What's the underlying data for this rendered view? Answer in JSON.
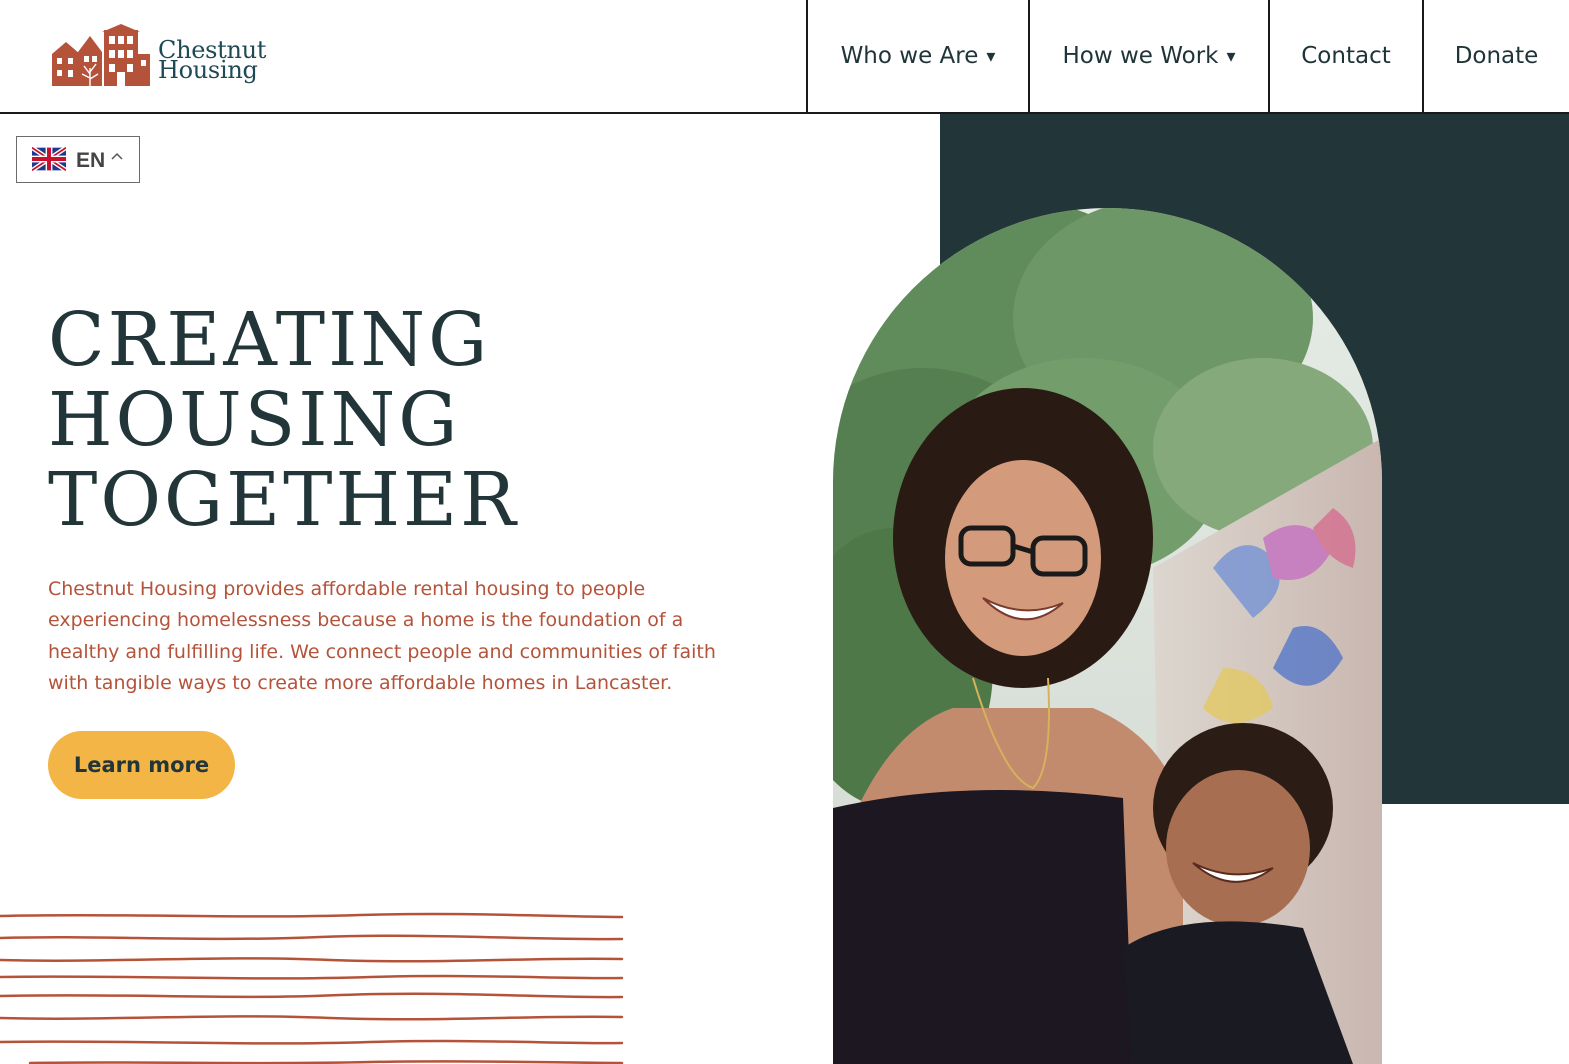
{
  "header": {
    "logo": {
      "line1": "Chestnut",
      "line2": "Housing"
    },
    "nav": [
      {
        "label": "Who we Are",
        "caret": "▾"
      },
      {
        "label": "How we Work",
        "caret": "▾"
      },
      {
        "label": "Contact"
      },
      {
        "label": "Donate"
      }
    ]
  },
  "language": {
    "code": "EN"
  },
  "hero": {
    "headline": [
      "CREATING",
      "HOUSING",
      "TOGETHER"
    ],
    "description": "Chestnut Housing provides affordable rental housing to people experiencing homelessness because a home is the foundation of a healthy and fulfilling life. We connect people and communities of faith with tangible ways to create more affordable homes in Lancaster.",
    "cta_label": "Learn more"
  },
  "colors": {
    "dark_teal": "#223539",
    "brick": "#b5533a",
    "button_gold": "#f3b546",
    "logo_teal": "#1f4a55"
  },
  "icons": [
    "chestnut-housing-logo-icon",
    "uk-flag-icon",
    "chevron-up-icon",
    "dropdown-caret-icon"
  ]
}
